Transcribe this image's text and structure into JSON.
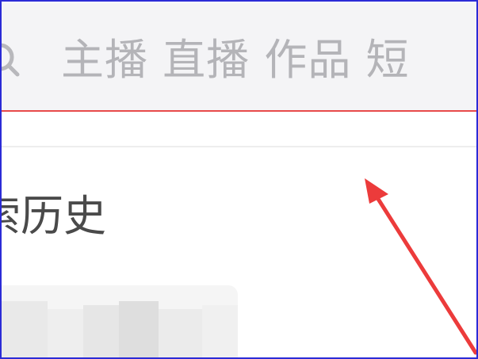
{
  "search": {
    "placeholder": "主播 直播 作品 短",
    "icon": "search-icon"
  },
  "history": {
    "title": "索历史"
  },
  "colors": {
    "accent": "#e84a4a",
    "frame": "#2b2bd6",
    "placeholder_text": "#b4b4b8",
    "title_text": "#4a4a4a"
  }
}
